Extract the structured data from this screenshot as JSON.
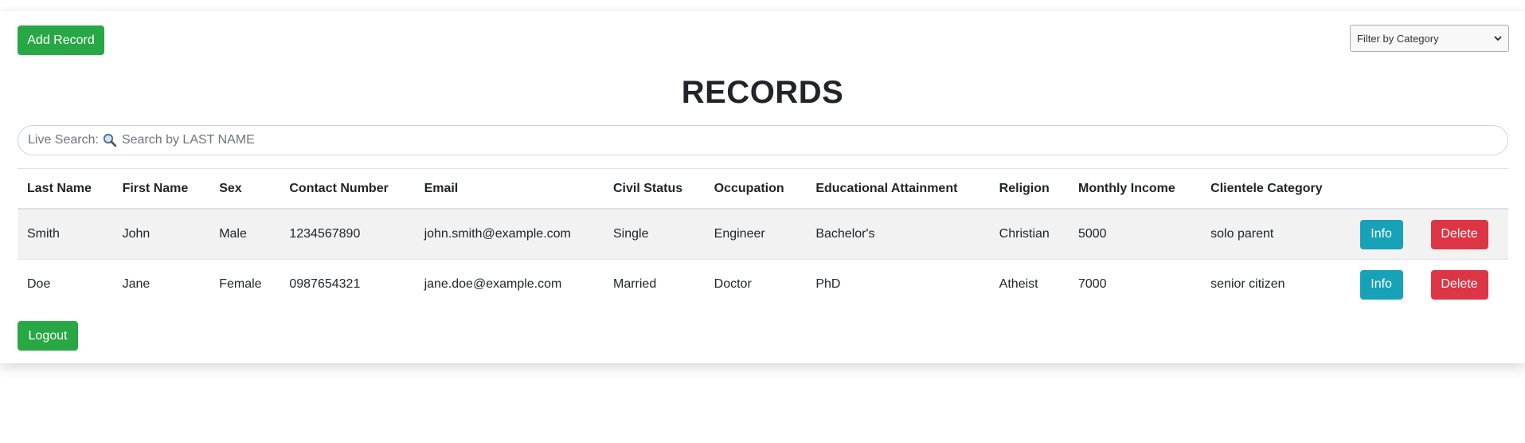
{
  "toolbar": {
    "add_label": "Add Record",
    "filter_selected": "Filter by Category"
  },
  "page": {
    "title": "RECORDS"
  },
  "search": {
    "label": "Live Search:",
    "placeholder": "Search by LAST NAME",
    "value": ""
  },
  "table": {
    "headers": [
      "Last Name",
      "First Name",
      "Sex",
      "Contact Number",
      "Email",
      "Civil Status",
      "Occupation",
      "Educational Attainment",
      "Religion",
      "Monthly Income",
      "Clientele Category",
      "",
      ""
    ],
    "rows": [
      {
        "last_name": "Smith",
        "first_name": "John",
        "sex": "Male",
        "contact": "1234567890",
        "email": "john.smith@example.com",
        "civil_status": "Single",
        "occupation": "Engineer",
        "education": "Bachelor's",
        "religion": "Christian",
        "income": "5000",
        "category": "solo parent",
        "info_label": "Info",
        "delete_label": "Delete"
      },
      {
        "last_name": "Doe",
        "first_name": "Jane",
        "sex": "Female",
        "contact": "0987654321",
        "email": "jane.doe@example.com",
        "civil_status": "Married",
        "occupation": "Doctor",
        "education": "PhD",
        "religion": "Atheist",
        "income": "7000",
        "category": "senior citizen",
        "info_label": "Info",
        "delete_label": "Delete"
      }
    ]
  },
  "footer": {
    "logout_label": "Logout"
  },
  "colors": {
    "success": "#28a745",
    "info": "#17a2b8",
    "danger": "#dc3545",
    "stripe": "#f2f2f2"
  },
  "icons": {
    "search": "magnifier-icon",
    "filter_dropdown": "chevron-down-icon"
  }
}
